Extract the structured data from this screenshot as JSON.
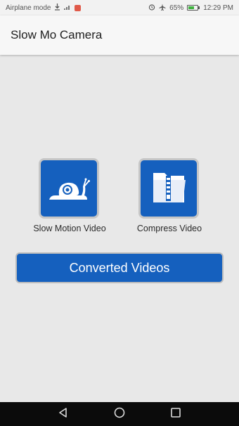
{
  "status_bar": {
    "left_text": "Airplane mode",
    "battery": "65%",
    "time": "12:29 PM",
    "icons": [
      "download-icon",
      "signal-icon",
      "notification-icon",
      "alarm-icon",
      "airplane-icon",
      "battery-icon"
    ]
  },
  "app_bar": {
    "title": "Slow Mo Camera"
  },
  "tiles": [
    {
      "label": "Slow Motion Video",
      "icon": "snail-icon"
    },
    {
      "label": "Compress Video",
      "icon": "zip-folder-icon"
    }
  ],
  "converted_button": {
    "label": "Converted Videos"
  },
  "colors": {
    "accent": "#1560be",
    "background": "#e8e8e8",
    "nav_bar": "#0b0b0b"
  },
  "nav_bar": {
    "icons": [
      "back-icon",
      "home-icon",
      "recents-icon"
    ]
  }
}
